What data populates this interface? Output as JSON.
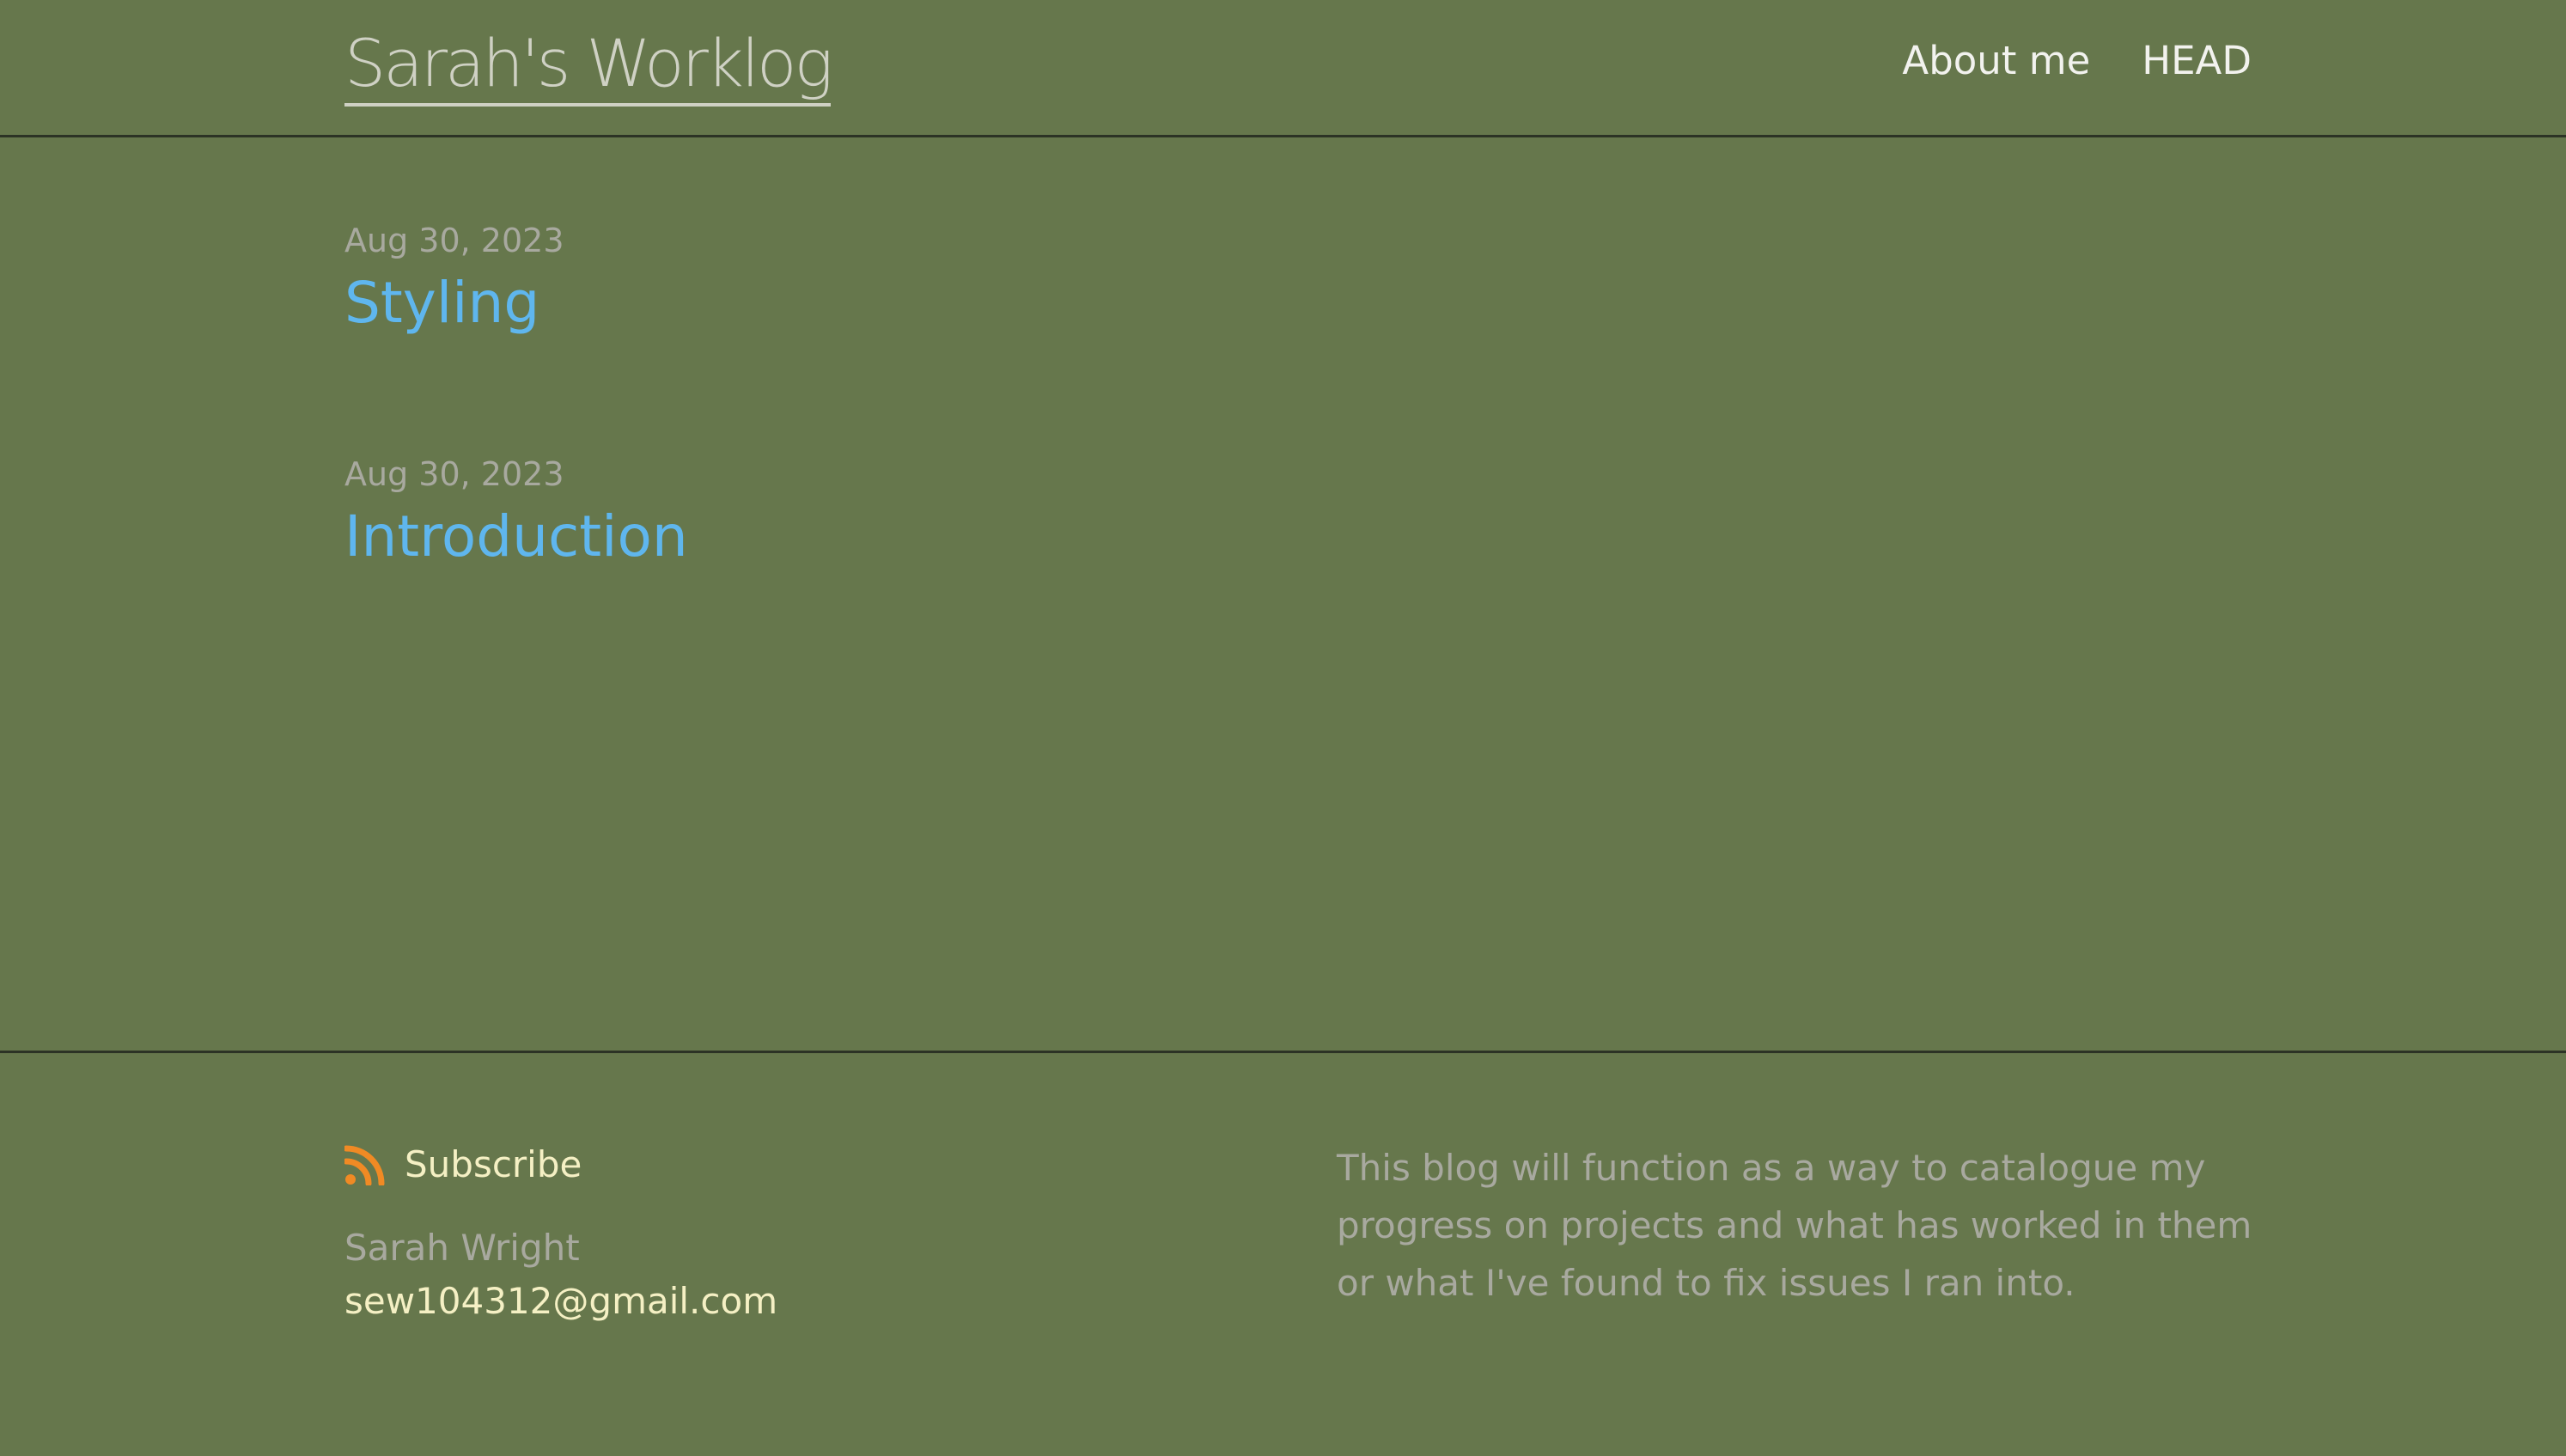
{
  "header": {
    "site_title": "Sarah's Worklog",
    "nav": [
      {
        "label": "About me"
      },
      {
        "label": "HEAD"
      }
    ]
  },
  "posts": [
    {
      "date": "Aug 30, 2023",
      "title": "Styling"
    },
    {
      "date": "Aug 30, 2023",
      "title": "Introduction"
    }
  ],
  "footer": {
    "subscribe_label": "Subscribe",
    "rss_icon": "rss-icon",
    "author_name": "Sarah Wright",
    "author_email": "sew104312@gmail.com",
    "description": "This blog will function as a way to catalogue my progress on projects and what has worked in them or what I've found to fix issues I ran into."
  },
  "colors": {
    "background": "#66774c",
    "divider": "#2c3325",
    "link_blue": "#5fb6ee",
    "muted_text": "#a8a99f",
    "accent_cream": "#f5f0c4",
    "rss_orange": "#f08a24"
  }
}
